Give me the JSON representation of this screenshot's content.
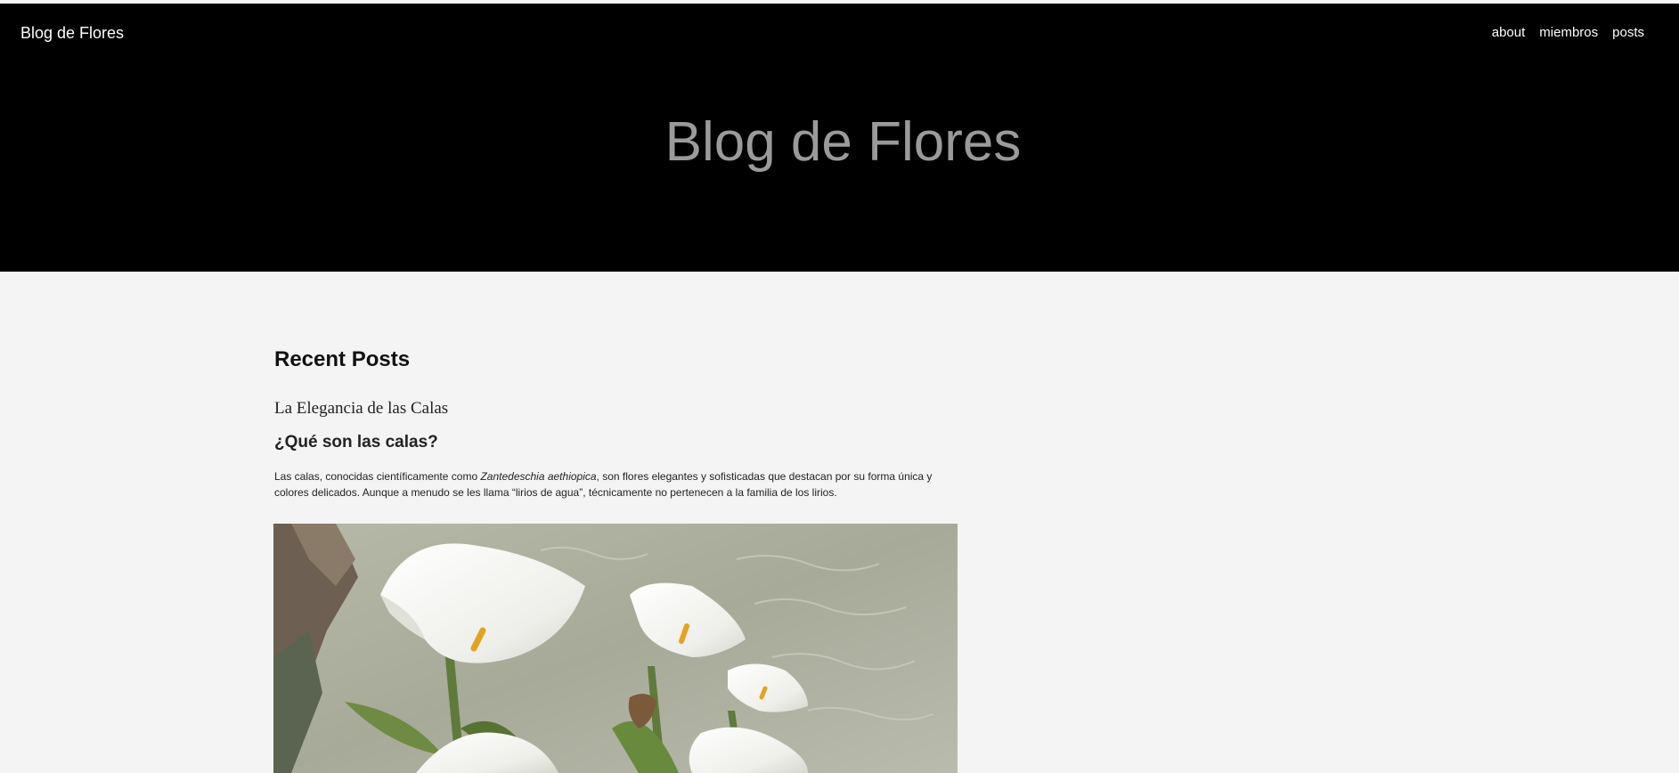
{
  "header": {
    "brand": "Blog de Flores",
    "nav": [
      "about",
      "miembros",
      "posts"
    ],
    "hero_title": "Blog de Flores"
  },
  "main": {
    "section_title": "Recent Posts",
    "post": {
      "title": "La Elegancia de las Calas",
      "heading": "¿Qué son las calas?",
      "text_before": "Las calas, conocidas científicamente como ",
      "text_italic": "Zantedeschia aethiopica",
      "text_after": ", son flores elegantes y sofisticadas que destacan por su forma única y colores delicados. Aunque a menudo se les llama “lirios de agua”, técnicamente no pertenecen a la familia de los lirios.",
      "image": "calla-lily-photo"
    }
  },
  "colors": {
    "hero_bg": "#000000",
    "hero_title": "#9a9a9a",
    "page_bg": "#f4f4f4"
  }
}
